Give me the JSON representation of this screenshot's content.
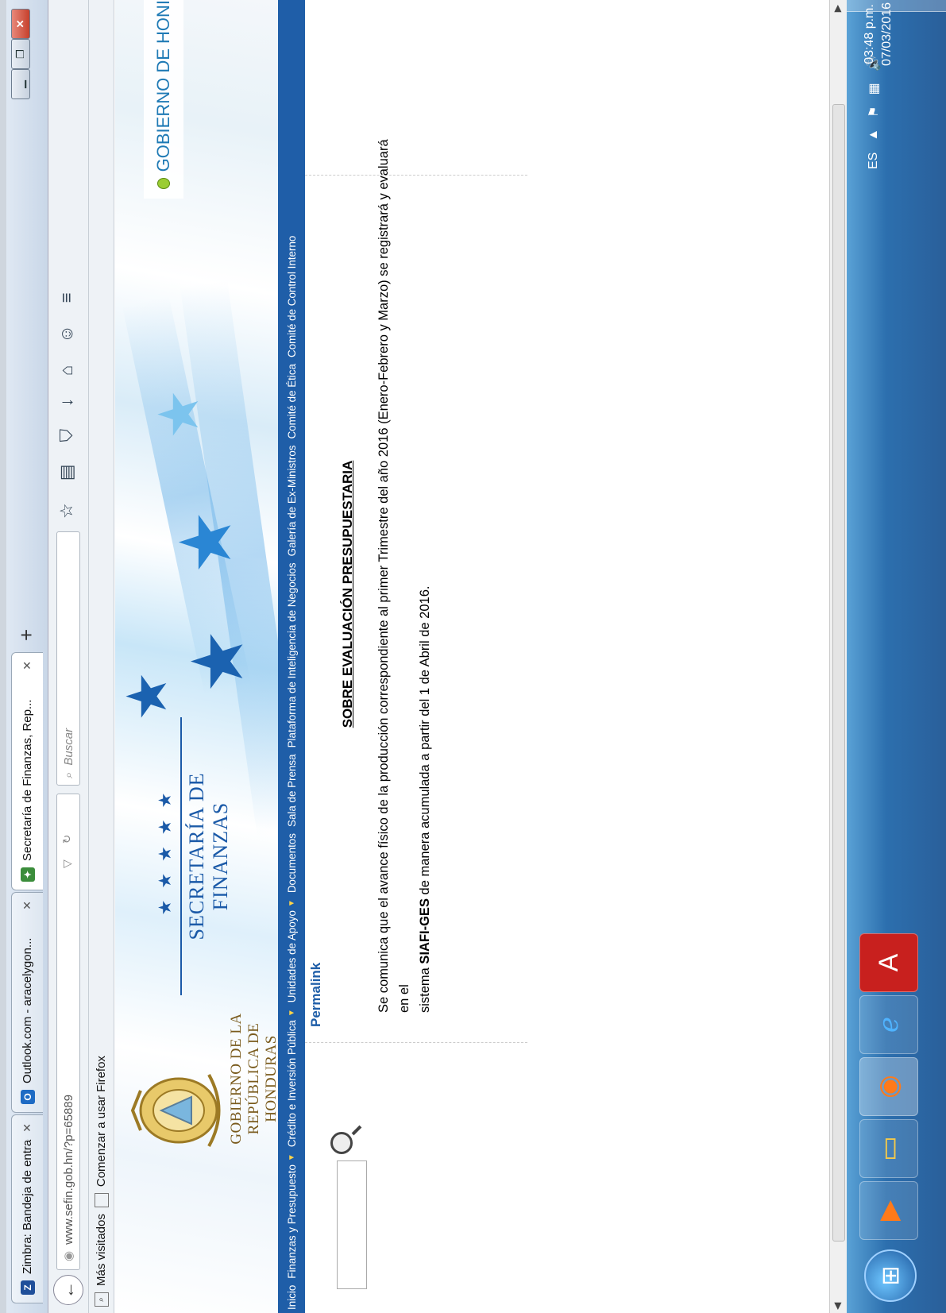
{
  "browser": {
    "tabs": [
      {
        "label": "Zimbra: Bandeja de entrada",
        "icon": "zimbra-icon"
      },
      {
        "label": "Outlook.com - aracelygon...",
        "icon": "outlook-icon"
      },
      {
        "label": "Secretaría de Finanzas, Rep...",
        "icon": "sefin-icon"
      }
    ],
    "new_tab": "+",
    "url": "www.sefin.gob.hn/?p=65889",
    "search_placeholder": "Buscar",
    "bookmarks": {
      "most_visited": "Más visitados",
      "getting_started": "Comenzar a usar Firefox"
    }
  },
  "site": {
    "gov_line1": "GOBIERNO DE LA",
    "gov_line2": "REPÚBLICA DE HONDURAS",
    "sefin_stars": "★★★★★",
    "sefin_title": "SECRETARÍA DE FINANZAS",
    "gobierno_link": "GOBIERNO DE HONI",
    "menu": [
      {
        "label": "Inicio",
        "dropdown": false
      },
      {
        "label": "Finanzas y Presupuesto",
        "dropdown": true
      },
      {
        "label": "Crédito e Inversión Pública",
        "dropdown": true
      },
      {
        "label": "Unidades de Apoyo",
        "dropdown": true
      },
      {
        "label": "Documentos",
        "dropdown": false
      },
      {
        "label": "Sala de Prensa",
        "dropdown": false
      },
      {
        "label": "Plataforma de Inteligencia de Negocios",
        "dropdown": false
      },
      {
        "label": "Galería de Ex-Ministros",
        "dropdown": false
      },
      {
        "label": "Comité de Ética",
        "dropdown": false
      },
      {
        "label": "Comité de Control Interno",
        "dropdown": false
      }
    ]
  },
  "post": {
    "permalink": "Permalink",
    "title": "SOBRE EVALUACIÓN PRESUPUESTARIA",
    "body_1": "Se comunica que el avance físico de la producción correspondiente al primer Trimestre del año 2016 (Enero-Febrero y Marzo) se registrará y evaluará en el",
    "body_2a": "sistema ",
    "body_2b": "SIAFI-GES",
    "body_2c": " de manera acumulada a partir del 1 de Abril de 2016."
  },
  "taskbar": {
    "language": "ES",
    "time": "03:48 p.m.",
    "date": "07/03/2016"
  },
  "colors": {
    "menu_bg": "#1f5ea8",
    "brand_blue": "#1b5aa8",
    "gov_gold": "#7a5b1d"
  }
}
